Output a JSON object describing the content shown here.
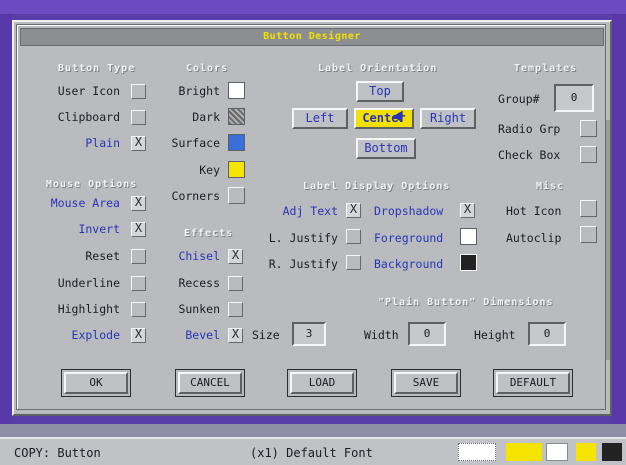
{
  "window": {
    "title": "Button Designer"
  },
  "sections": {
    "button_type": "Button Type",
    "colors": "Colors",
    "label_orientation": "Label Orientation",
    "templates": "Templates",
    "mouse_options": "Mouse Options",
    "effects": "Effects",
    "label_display": "Label Display Options",
    "misc": "Misc",
    "plain_dims": "\"Plain Button\" Dimensions"
  },
  "button_type": [
    {
      "label": "User Icon",
      "checked": false
    },
    {
      "label": "Clipboard",
      "checked": false
    },
    {
      "label": "Plain",
      "checked": true
    }
  ],
  "colors": [
    {
      "label": "Bright",
      "color": "#ffffff"
    },
    {
      "label": "Dark",
      "color": "#8a8a8a"
    },
    {
      "label": "Surface",
      "color": "#3a6ed8"
    },
    {
      "label": "Key",
      "color": "#f4e400"
    },
    {
      "label": "Corners",
      "color": "#b9bbbf"
    }
  ],
  "orientation": {
    "top": "Top",
    "left": "Left",
    "center": "Center",
    "right": "Right",
    "bottom": "Bottom",
    "selected": "center"
  },
  "templates": {
    "group_label": "Group#",
    "group_value": "0",
    "radio": "Radio Grp",
    "check": "Check Box"
  },
  "mouse_options": [
    {
      "label": "Mouse Area",
      "checked": true
    },
    {
      "label": "Invert",
      "checked": true
    },
    {
      "label": "Reset",
      "checked": false
    },
    {
      "label": "Underline",
      "checked": false
    },
    {
      "label": "Highlight",
      "checked": false
    },
    {
      "label": "Explode",
      "checked": true
    }
  ],
  "effects": [
    {
      "label": "Chisel",
      "checked": true
    },
    {
      "label": "Recess",
      "checked": false
    },
    {
      "label": "Sunken",
      "checked": false
    },
    {
      "label": "Bevel",
      "checked": true
    }
  ],
  "size": {
    "label": "Size",
    "value": "3"
  },
  "label_display": {
    "adj_text": "Adj Text",
    "dropshadow": "Dropshadow",
    "l_justify": "L. Justify",
    "foreground": "Foreground",
    "r_justify": "R. Justify",
    "background": "Background",
    "foreground_color": "#ffffff",
    "background_color": "#222222"
  },
  "misc": {
    "hot_icon": "Hot Icon",
    "autoclip": "Autoclip"
  },
  "dims": {
    "width_label": "Width",
    "width_value": "0",
    "height_label": "Height",
    "height_value": "0"
  },
  "actions": {
    "ok": "OK",
    "cancel": "CANCEL",
    "load": "LOAD",
    "save": "SAVE",
    "default": "DEFAULT"
  },
  "status": {
    "left": "COPY: Button",
    "center": "(x1) Default Font"
  },
  "status_swatches": [
    "#ffffff",
    "#f4e400",
    "#ffffff",
    "#f4e400",
    "#222222"
  ]
}
